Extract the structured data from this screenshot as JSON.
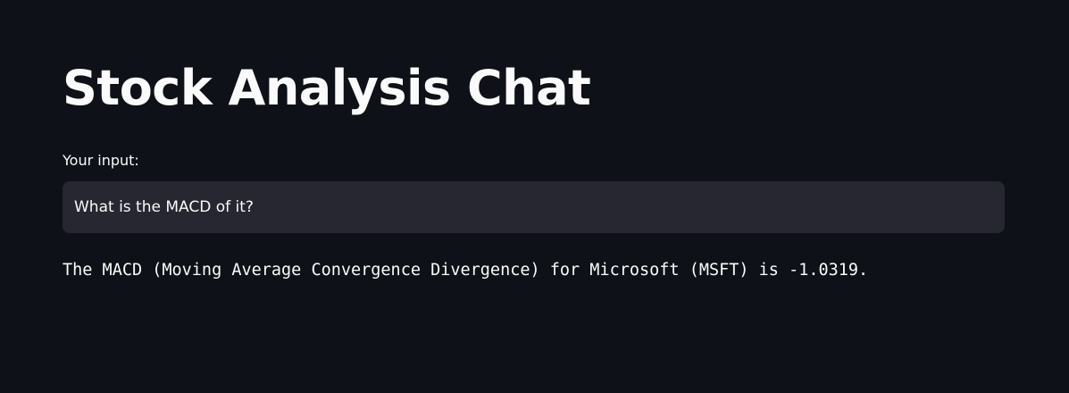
{
  "app": {
    "title": "Stock Analysis Chat"
  },
  "input": {
    "label": "Your input:",
    "value": "What is the MACD of it?",
    "placeholder": ""
  },
  "response": {
    "text": "The MACD (Moving Average Convergence Divergence) for Microsoft (MSFT) is -1.0319."
  },
  "colors": {
    "background": "#0e1117",
    "input_background": "#262730",
    "text": "#fafafa"
  }
}
